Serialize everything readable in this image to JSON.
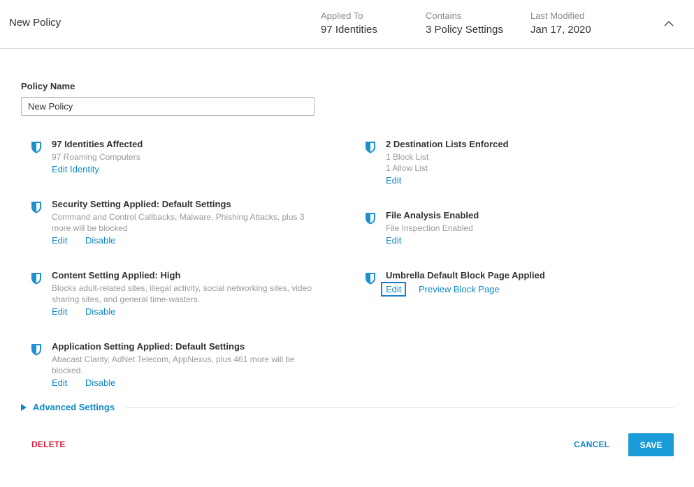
{
  "header": {
    "title": "New Policy",
    "applied_to": {
      "label": "Applied To",
      "value": "97 Identities"
    },
    "contains": {
      "label": "Contains",
      "value": "3 Policy Settings"
    },
    "last_modified": {
      "label": "Last Modified",
      "value": "Jan 17, 2020"
    },
    "collapse_icon": "chevron-up-icon"
  },
  "policy_name": {
    "label": "Policy Name",
    "value": "New Policy"
  },
  "left_items": [
    {
      "heading": "97 Identities Affected",
      "desc": "97 Roaming Computers",
      "links": [
        "Edit Identity"
      ]
    },
    {
      "heading": "Security Setting Applied: Default Settings",
      "desc": "Command and Control Callbacks, Malware, Phishing Attacks, plus 3 more will be blocked",
      "links": [
        "Edit",
        "Disable"
      ]
    },
    {
      "heading": "Content Setting Applied: High",
      "desc": "Blocks adult-related sites, illegal activity, social networking sites, video sharing sites, and general time-wasters.",
      "links": [
        "Edit",
        "Disable"
      ]
    },
    {
      "heading": "Application Setting Applied: Default Settings",
      "desc": "Abacast Clarity, AdNet Telecom, AppNexus, plus 461 more will be blocked.",
      "links": [
        "Edit",
        "Disable"
      ]
    }
  ],
  "right_items": [
    {
      "heading": "2 Destination Lists Enforced",
      "desc1": "1 Block List",
      "desc2": "1 Allow List",
      "links": [
        "Edit"
      ]
    },
    {
      "heading": "File Analysis Enabled",
      "desc": "File Inspection Enabled",
      "links": [
        "Edit"
      ]
    },
    {
      "heading": "Umbrella Default Block Page Applied",
      "links": [
        "Edit",
        "Preview Block Page"
      ]
    }
  ],
  "advanced": {
    "label": "Advanced Settings"
  },
  "footer": {
    "delete_label": "DELETE",
    "cancel_label": "CANCEL",
    "save_label": "SAVE"
  },
  "colors": {
    "accent": "#0d89c6",
    "save_bg": "#1b9bd7",
    "danger": "#d0223b",
    "shield": "#1e8fd1"
  }
}
